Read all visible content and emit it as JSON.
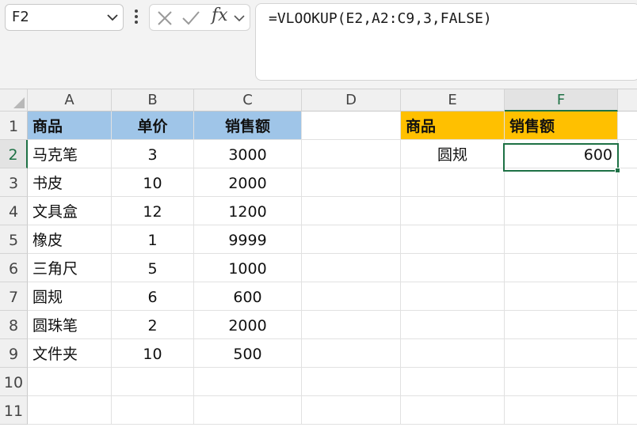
{
  "name_box": {
    "value": "F2"
  },
  "formula_bar": {
    "fx_label": "fx",
    "formula": "=VLOOKUP(E2,A2:C9,3,FALSE)"
  },
  "columns": [
    "A",
    "B",
    "C",
    "D",
    "E",
    "F"
  ],
  "rows": [
    "1",
    "2",
    "3",
    "4",
    "5",
    "6",
    "7",
    "8",
    "9",
    "10",
    "11"
  ],
  "active_cell": {
    "column": "F",
    "row": "2"
  },
  "colors": {
    "header_blue": "#9fc5e8",
    "header_gold": "#ffc000",
    "selection_green": "#1e7145"
  },
  "table": {
    "headers": [
      "商品",
      "单价",
      "销售额"
    ],
    "rows": [
      [
        "马克笔",
        "3",
        "3000"
      ],
      [
        "书皮",
        "10",
        "2000"
      ],
      [
        "文具盒",
        "12",
        "1200"
      ],
      [
        "橡皮",
        "1",
        "9999"
      ],
      [
        "三角尺",
        "5",
        "1000"
      ],
      [
        "圆规",
        "6",
        "600"
      ],
      [
        "圆珠笔",
        "2",
        "2000"
      ],
      [
        "文件夹",
        "10",
        "500"
      ]
    ]
  },
  "lookup": {
    "headers": [
      "商品",
      "销售额"
    ],
    "item": "圆规",
    "result": "600"
  }
}
